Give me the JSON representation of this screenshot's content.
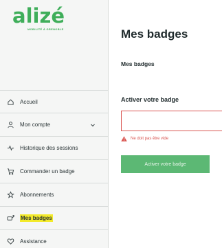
{
  "brand": {
    "logo_text": "alizé",
    "tagline": "MOBILITÉ À GRENOBLE",
    "accent_color": "#3fae5a"
  },
  "sidebar": {
    "items": [
      {
        "label": "Accueil",
        "icon": "home-icon"
      },
      {
        "label": "Mon compte",
        "icon": "user-icon",
        "has_submenu": true
      },
      {
        "label": "Historique des sessions",
        "icon": "activity-icon"
      },
      {
        "label": "Commander un badge",
        "icon": "cart-icon"
      },
      {
        "label": "Abonnements",
        "icon": "star-icon"
      },
      {
        "label": "Mes badges",
        "icon": "badge-card-icon",
        "active": true
      },
      {
        "label": "Assistance",
        "icon": "heart-icon"
      }
    ]
  },
  "main": {
    "title": "Mes badges",
    "subtitle": "Mes badges",
    "form": {
      "label": "Activer votre badge",
      "input_value": "",
      "error": "Ne doit pas être vide",
      "submit_label": "Activer votre badge",
      "submit_color": "#5cb874",
      "error_color": "#d9534f"
    }
  }
}
